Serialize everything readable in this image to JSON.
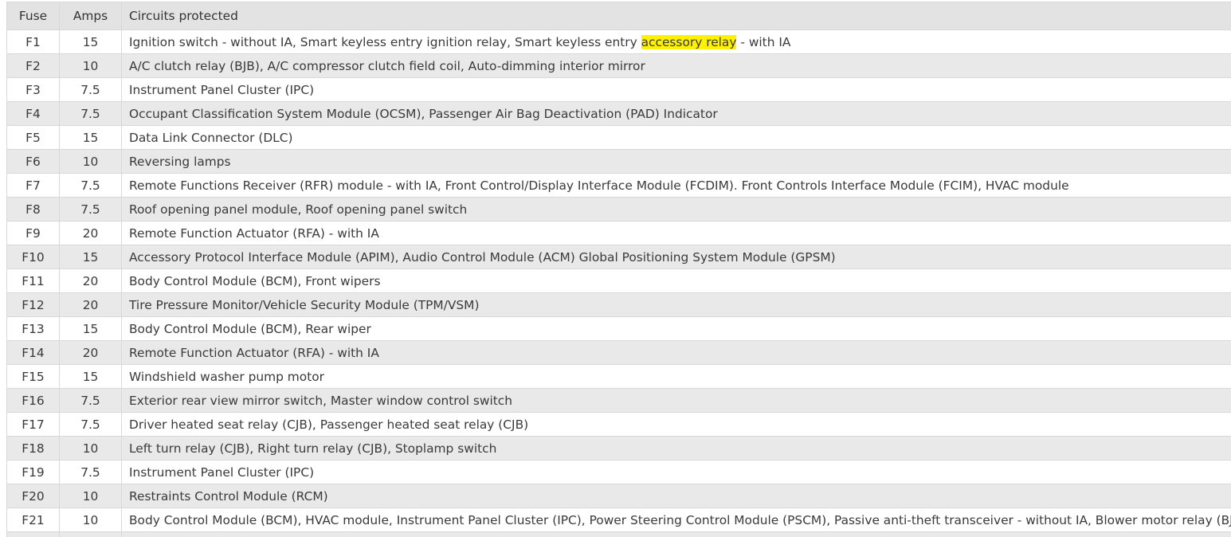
{
  "table": {
    "headers": {
      "fuse": "Fuse",
      "amps": "Amps",
      "circuits": "Circuits protected"
    },
    "rows": [
      {
        "fuse": "F1",
        "amps": "15",
        "circuits_before": "Ignition switch - without IA, Smart keyless entry ignition relay, Smart keyless entry ",
        "circuits_highlight": "accessory relay",
        "circuits_after": " - with IA"
      },
      {
        "fuse": "F2",
        "amps": "10",
        "circuits": "A/C clutch relay (BJB), A/C compressor clutch field coil, Auto-dimming interior mirror"
      },
      {
        "fuse": "F3",
        "amps": "7.5",
        "circuits": "Instrument Panel Cluster (IPC)"
      },
      {
        "fuse": "F4",
        "amps": "7.5",
        "circuits": "Occupant Classification System Module (OCSM), Passenger Air Bag Deactivation (PAD) Indicator"
      },
      {
        "fuse": "F5",
        "amps": "15",
        "circuits": "Data Link Connector (DLC)"
      },
      {
        "fuse": "F6",
        "amps": "10",
        "circuits": "Reversing lamps"
      },
      {
        "fuse": "F7",
        "amps": "7.5",
        "circuits": "Remote Functions Receiver (RFR) module - with IA, Front Control/Display Interface Module (FCDIM). Front Controls Interface Module (FCIM), HVAC module"
      },
      {
        "fuse": "F8",
        "amps": "7.5",
        "circuits": "Roof opening panel module, Roof opening panel switch"
      },
      {
        "fuse": "F9",
        "amps": "20",
        "circuits": "Remote Function Actuator (RFA) - with IA"
      },
      {
        "fuse": "F10",
        "amps": "15",
        "circuits": "Accessory Protocol Interface Module (APIM), Audio Control Module (ACM) Global Positioning System Module (GPSM)"
      },
      {
        "fuse": "F11",
        "amps": "20",
        "circuits": "Body Control Module (BCM), Front wipers"
      },
      {
        "fuse": "F12",
        "amps": "20",
        "circuits": "Tire Pressure Monitor/Vehicle Security Module (TPM/VSM)"
      },
      {
        "fuse": "F13",
        "amps": "15",
        "circuits": "Body Control Module (BCM), Rear wiper"
      },
      {
        "fuse": "F14",
        "amps": "20",
        "circuits": "Remote Function Actuator (RFA) - with IA"
      },
      {
        "fuse": "F15",
        "amps": "15",
        "circuits": "Windshield washer pump motor"
      },
      {
        "fuse": "F16",
        "amps": "7.5",
        "circuits": "Exterior rear view mirror switch, Master window control switch"
      },
      {
        "fuse": "F17",
        "amps": "7.5",
        "circuits": "Driver heated seat relay (CJB), Passenger heated seat relay (CJB)"
      },
      {
        "fuse": "F18",
        "amps": "10",
        "circuits": "Left turn relay (CJB), Right turn relay (CJB), Stoplamp switch"
      },
      {
        "fuse": "F19",
        "amps": "7.5",
        "circuits": "Instrument Panel Cluster (IPC)"
      },
      {
        "fuse": "F20",
        "amps": "10",
        "circuits": "Restraints Control Module (RCM)"
      },
      {
        "fuse": "F21",
        "amps": "10",
        "circuits": "Body Control Module (BCM), HVAC module, Instrument Panel Cluster (IPC), Power Steering Control Module (PSCM), Passive anti-theft transceiver - without IA, Blower motor relay (BJB)"
      }
    ]
  },
  "colors": {
    "header_bg": "#e3e3e3",
    "row_alt_bg": "#e9e9e9",
    "grid_line": "#d8d8d8",
    "highlight": "#fff200"
  }
}
